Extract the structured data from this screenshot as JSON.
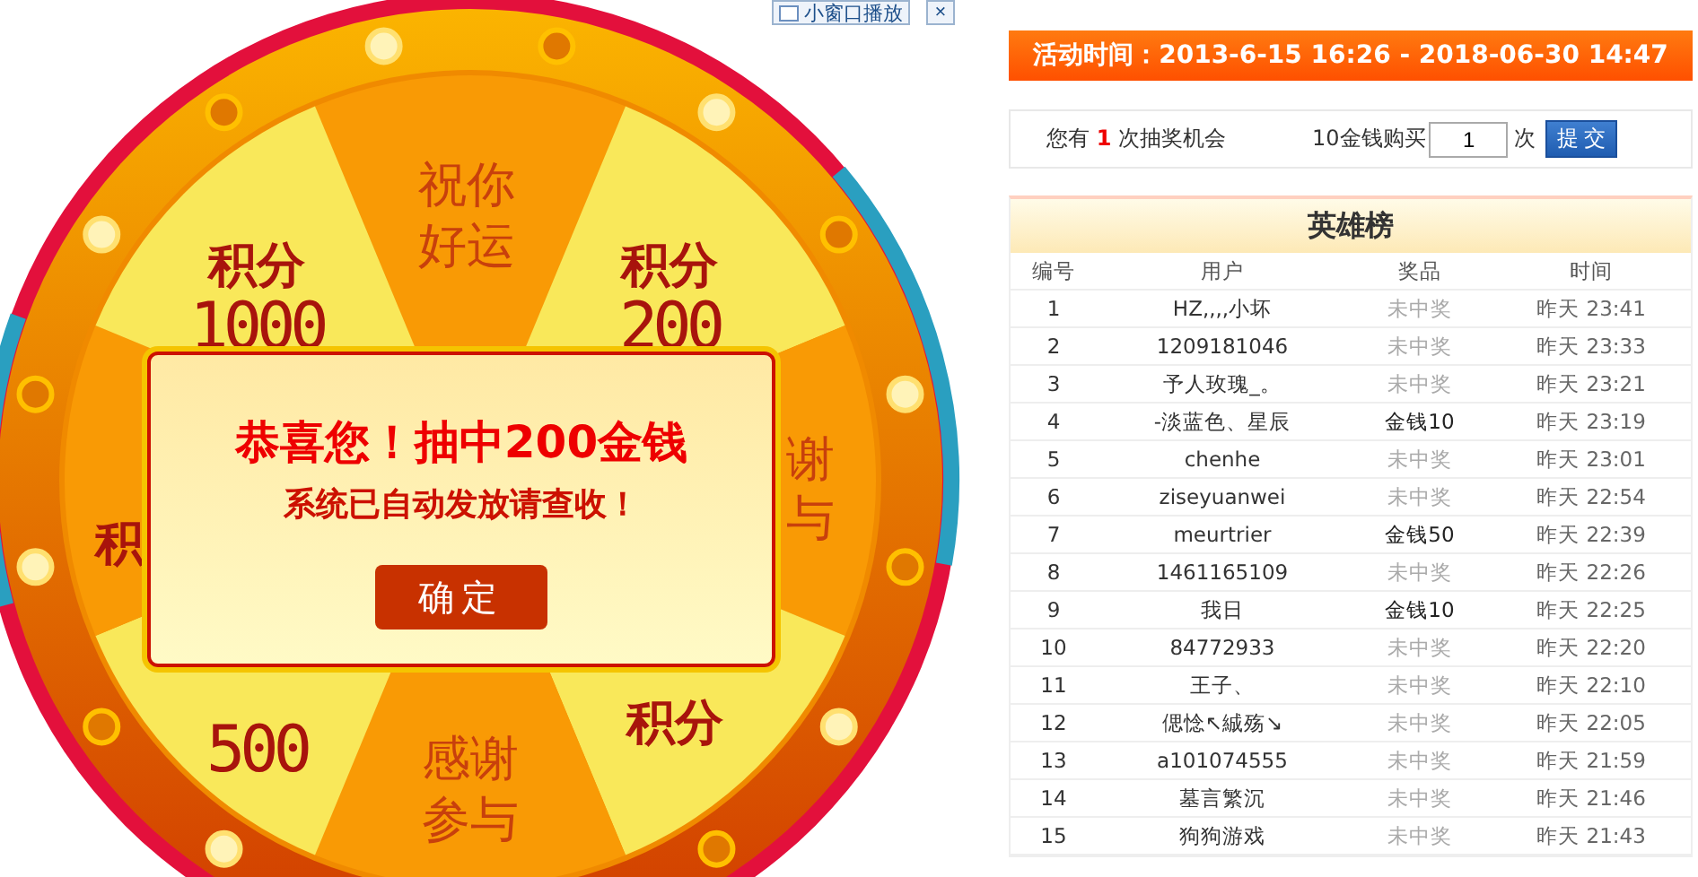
{
  "mini_player": {
    "label": "小窗口播放",
    "close": "×"
  },
  "wheel": {
    "segments": [
      {
        "lines": [
          "祝你",
          "好运"
        ]
      },
      {
        "lines": [
          "积分",
          "200"
        ]
      },
      {
        "lines": [
          "谢",
          "与"
        ]
      },
      {
        "lines": [
          "积分"
        ]
      },
      {
        "lines": [
          "感谢",
          "参与"
        ]
      },
      {
        "lines": [
          "500"
        ]
      },
      {
        "lines": [
          "积"
        ]
      },
      {
        "lines": [
          "积分",
          "1000"
        ]
      }
    ]
  },
  "popup": {
    "title": "恭喜您！抽中200金钱",
    "message": "系统已自动发放请查收！",
    "button": "确定"
  },
  "activity": {
    "title": "活动时间：2013-6-15 16:26 - 2018-06-30 14:47"
  },
  "chances": {
    "prefix": "您有",
    "count": "1",
    "suffix": "次抽奖机会",
    "buy_label": "10金钱购买",
    "quantity": "1",
    "unit": "次",
    "submit": "提 交"
  },
  "leaderboard": {
    "title": "英雄榜",
    "columns": [
      "编号",
      "用户",
      "奖品",
      "时间"
    ],
    "rows": [
      {
        "no": "1",
        "user": "HZ,,,,小坏",
        "prize": "未中奖",
        "won": false,
        "time": "昨天 23:41"
      },
      {
        "no": "2",
        "user": "1209181046",
        "prize": "未中奖",
        "won": false,
        "time": "昨天 23:33"
      },
      {
        "no": "3",
        "user": "予人玫瑰_。",
        "prize": "未中奖",
        "won": false,
        "time": "昨天 23:21"
      },
      {
        "no": "4",
        "user": "-淡蓝色、星辰",
        "prize": "金钱10",
        "won": true,
        "time": "昨天 23:19"
      },
      {
        "no": "5",
        "user": "chenhe",
        "prize": "未中奖",
        "won": false,
        "time": "昨天 23:01"
      },
      {
        "no": "6",
        "user": "ziseyuanwei",
        "prize": "未中奖",
        "won": false,
        "time": "昨天 22:54"
      },
      {
        "no": "7",
        "user": "meurtrier",
        "prize": "金钱50",
        "won": true,
        "time": "昨天 22:39"
      },
      {
        "no": "8",
        "user": "1461165109",
        "prize": "未中奖",
        "won": false,
        "time": "昨天 22:26"
      },
      {
        "no": "9",
        "user": "我日",
        "prize": "金钱10",
        "won": true,
        "time": "昨天 22:25"
      },
      {
        "no": "10",
        "user": "84772933",
        "prize": "未中奖",
        "won": false,
        "time": "昨天 22:20"
      },
      {
        "no": "11",
        "user": "王子、",
        "prize": "未中奖",
        "won": false,
        "time": "昨天 22:10"
      },
      {
        "no": "12",
        "user": "偲惗↖絾殇↘",
        "prize": "未中奖",
        "won": false,
        "time": "昨天 22:05"
      },
      {
        "no": "13",
        "user": "a101074555",
        "prize": "未中奖",
        "won": false,
        "time": "昨天 21:59"
      },
      {
        "no": "14",
        "user": "墓言繁沉",
        "prize": "未中奖",
        "won": false,
        "time": "昨天 21:46"
      },
      {
        "no": "15",
        "user": "狗狗游戏",
        "prize": "未中奖",
        "won": false,
        "time": "昨天 21:43"
      }
    ]
  }
}
